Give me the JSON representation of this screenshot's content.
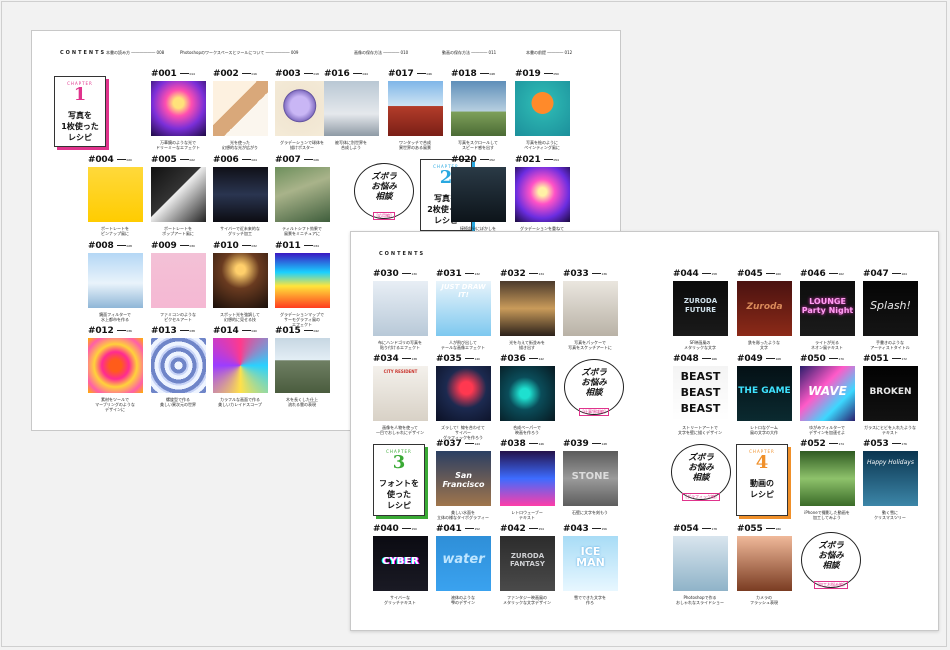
{
  "sheet1": {
    "contents_label": "CONTENTS",
    "headers": [
      "本書の読み方 ―――――― 008",
      "Photoshopのワークスペースとツールについて ―――――― 009",
      "画像の保存方法 ―――― 010",
      "動画の保存方法 ―――― 011",
      "本書の前提 ―――― 012"
    ],
    "chapter": {
      "label": "CHAPTER",
      "number": "1",
      "title": "写真を\n1枚使った\nレシピ"
    },
    "chapter2": {
      "label": "CHAPTER",
      "number": "2",
      "title": "写真を\n2枚使った\nレシピ"
    },
    "bubble": {
      "title": "ズボラ\nお悩み\n相談",
      "sub": "[応用編]"
    },
    "items": [
      {
        "id": "#001",
        "page": "014",
        "caption": "万華鏡のような光で\nドリーミーなエフェクト"
      },
      {
        "id": "#002",
        "page": "016",
        "caption": "光を使った\n幻想的な光が広がり"
      },
      {
        "id": "#003",
        "page": "018",
        "caption": "グラデーションで球体を\n描けポスター"
      },
      {
        "id": "#004",
        "page": "020",
        "caption": "ポートレートを\nピンナップ風に"
      },
      {
        "id": "#005",
        "page": "022",
        "caption": "ポートレートを\nポップアート風に"
      },
      {
        "id": "#006",
        "page": "024",
        "caption": "サイバーで近未来的な\nグリッチ加工"
      },
      {
        "id": "#007",
        "page": "026",
        "caption": "ティルトシフト効果で\n風景をミニチュアに"
      },
      {
        "id": "#008",
        "page": "028",
        "caption": "鏡面フィルターで\n水上都市を作る"
      },
      {
        "id": "#009",
        "page": "030",
        "caption": "ファミコンのような\nピクセルアート"
      },
      {
        "id": "#010",
        "page": "032",
        "caption": "スポット光を強調して\n幻想的に見せる技"
      },
      {
        "id": "#011",
        "page": "034",
        "caption": "グラデーションマップで\nサーモグラフィ風の\nエフェクト"
      },
      {
        "id": "#012",
        "page": "036",
        "caption": "素材をツールで\nマーブリングのような\nデザインに"
      },
      {
        "id": "#013",
        "page": "038",
        "caption": "螺旋型で作る\n美しい異次元の世界"
      },
      {
        "id": "#014",
        "page": "040",
        "caption": "カラフルな画面で作る\n美しいカレイドスコープ"
      },
      {
        "id": "#015",
        "page": "042",
        "caption": "木を長くした仕上\n流れる雲の表現"
      },
      {
        "id": "#016",
        "page": "044",
        "caption": "被写体に別世界を\n合成しよう"
      },
      {
        "id": "#017",
        "page": "046",
        "caption": "ワンタッチで合成\n異世界のある風景"
      },
      {
        "id": "#018",
        "page": "048",
        "caption": "写真をスクロールして\nスピード感を出す"
      },
      {
        "id": "#019",
        "page": "050",
        "caption": "写真を絵のように\nペインティング風に"
      },
      {
        "id": "#020",
        "page": "052",
        "caption": "接続部分にぼかしを\nスピード感のある表現"
      },
      {
        "id": "#021",
        "page": "054",
        "caption": "グラデーションを重ねて\n作品に彩りを与える"
      }
    ]
  },
  "sheet2": {
    "contents_label": "CONTENTS",
    "chapter3": {
      "label": "CHAPTER",
      "number": "3",
      "title": "フォントを\n使った\nレシピ"
    },
    "chapter4": {
      "label": "CHAPTER",
      "number": "4",
      "title": "動画の\nレシピ"
    },
    "bubbles": [
      {
        "title": "ズボラ\nお悩み\n相談",
        "sub": "[仕事領域編]"
      },
      {
        "title": "ズボラ\nお悩み\n相談",
        "sub": "[グラフィック編]"
      },
      {
        "title": "ズボラ\nお悩み\n相談",
        "sub": "[加工お悩み編]"
      }
    ],
    "items": [
      {
        "id": "#030",
        "page": "130",
        "caption": "布にハンドゴリの写真を\n貼り付けるエフェクト",
        "text": ""
      },
      {
        "id": "#031",
        "page": "132",
        "caption": "人が飛び出して\nテールな画像エフェクト",
        "text": "JUST DRAW IT!"
      },
      {
        "id": "#032",
        "page": "134",
        "caption": "光を与えて街並みを\n描き出す",
        "text": ""
      },
      {
        "id": "#033",
        "page": "136",
        "caption": "写真をパッケーで\n写真をスケッチアートに",
        "text": ""
      },
      {
        "id": "#034",
        "page": "138",
        "caption": "画像を人物を使って\n一目でおしゃれにデザイン",
        "text": "CITY RESIDENT"
      },
      {
        "id": "#035",
        "page": "140",
        "caption": "ズラして！線を合わせて\nサイバー\nグラフィックを作ろう",
        "text": ""
      },
      {
        "id": "#036",
        "page": "142",
        "caption": "合成ペーパーで\n映画を作ろう",
        "text": ""
      },
      {
        "id": "#037",
        "page": "144",
        "caption": "美しい水面を\n立体の様なタイポグラフィー",
        "text": "San Francisco"
      },
      {
        "id": "#038",
        "page": "146",
        "caption": "レトロウェーブー\nテキスト",
        "text": ""
      },
      {
        "id": "#039",
        "page": "148",
        "caption": "石壁に文字を刻もう",
        "text": "STONE"
      },
      {
        "id": "#040",
        "page": "150",
        "caption": "サイバーな\nグリッチテキスト",
        "text": "CYBER"
      },
      {
        "id": "#041",
        "page": "152",
        "caption": "液体のような\n雫のデザイン",
        "text": "water"
      },
      {
        "id": "#042",
        "page": "154",
        "caption": "ファンタジー映画風の\nメタリックな文字デザイン",
        "text": "ZURODA\nFANTASY"
      },
      {
        "id": "#043",
        "page": "156",
        "caption": "雪でできた文字を\n作ろ",
        "text": "ICE\nMAN"
      },
      {
        "id": "#044",
        "page": "158",
        "caption": "SF映画風の\nメタリックな文字",
        "text": "ZURODA\nFUTURE"
      },
      {
        "id": "#045",
        "page": "160",
        "caption": "鉄を彫ったような\n文字",
        "text": "Zuroda"
      },
      {
        "id": "#046",
        "page": "162",
        "caption": "ライトが光る\nネオン風テキスト",
        "text": "LOUNGE\nParty Night"
      },
      {
        "id": "#047",
        "page": "164",
        "caption": "手書きのような\nアーティストタイトル",
        "text": "Splash!"
      },
      {
        "id": "#048",
        "page": "166",
        "caption": "ストリートアートで\n文字を壁に描くデザイン",
        "text": "BEAST\nBEAST\nBEAST"
      },
      {
        "id": "#049",
        "page": "168",
        "caption": "レトロなゲーム\n風の文字の大作",
        "text": "THE GAME"
      },
      {
        "id": "#050",
        "page": "170",
        "caption": "ゆがみフィルターで\nデザインを加速せよ",
        "text": "WAVE"
      },
      {
        "id": "#051",
        "page": "172",
        "caption": "ガラスにヒビを入れたような\nテキスト",
        "text": "BROKEN"
      },
      {
        "id": "#052",
        "page": "174",
        "caption": "iPhoneで撮影した動画を\n加工してみよう",
        "text": ""
      },
      {
        "id": "#053",
        "page": "176",
        "caption": "動く雪に\nクリスマスツリー",
        "text": "Happy Holidays"
      },
      {
        "id": "#054",
        "page": "178",
        "caption": "Photoshopで作る\nおしゃれなスライドショー",
        "text": ""
      },
      {
        "id": "#055",
        "page": "180",
        "caption": "カメラの\nフラッシュ表現",
        "text": ""
      }
    ]
  },
  "colors": {
    "chapter1": "#e0338c",
    "chapter2": "#29a8e0",
    "chapter3": "#3aaa35",
    "chapter4": "#f0902a"
  }
}
